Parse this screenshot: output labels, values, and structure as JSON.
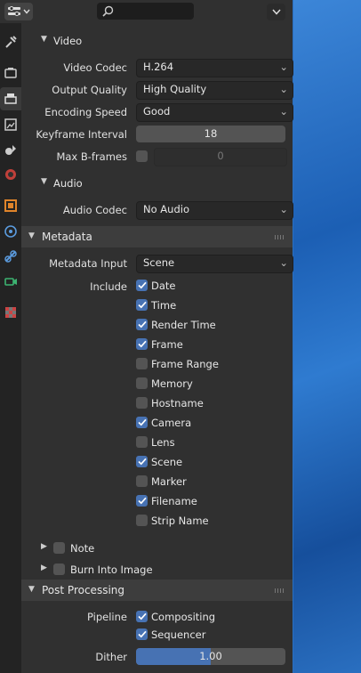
{
  "header": {
    "search_placeholder": ""
  },
  "tabs": [
    "tool-icon",
    "render-icon",
    "output-icon",
    "view-layer-icon",
    "scene-icon",
    "world-icon",
    "object-icon",
    "physics-icon",
    "constraints-icon",
    "data-icon",
    "texture-icon"
  ],
  "video": {
    "title": "Video",
    "codec_label": "Video Codec",
    "codec": "H.264",
    "quality_label": "Output Quality",
    "quality": "High Quality",
    "speed_label": "Encoding Speed",
    "speed": "Good",
    "keyframe_label": "Keyframe Interval",
    "keyframe": "18",
    "bframes_label": "Max B-frames",
    "bframes": "0"
  },
  "audio": {
    "title": "Audio",
    "codec_label": "Audio Codec",
    "codec": "No Audio"
  },
  "metadata": {
    "title": "Metadata",
    "input_label": "Metadata Input",
    "input": "Scene",
    "include_label": "Include",
    "items": [
      {
        "label": "Date",
        "checked": true
      },
      {
        "label": "Time",
        "checked": true
      },
      {
        "label": "Render Time",
        "checked": true
      },
      {
        "label": "Frame",
        "checked": true
      },
      {
        "label": "Frame Range",
        "checked": false
      },
      {
        "label": "Memory",
        "checked": false
      },
      {
        "label": "Hostname",
        "checked": false
      },
      {
        "label": "Camera",
        "checked": true
      },
      {
        "label": "Lens",
        "checked": false
      },
      {
        "label": "Scene",
        "checked": true
      },
      {
        "label": "Marker",
        "checked": false
      },
      {
        "label": "Filename",
        "checked": true
      },
      {
        "label": "Strip Name",
        "checked": false
      }
    ],
    "note": "Note",
    "burn": "Burn Into Image"
  },
  "post": {
    "title": "Post Processing",
    "pipeline_label": "Pipeline",
    "compositing": "Compositing",
    "sequencer": "Sequencer",
    "dither_label": "Dither",
    "dither": "1.00",
    "dither_fraction": 0.5
  },
  "colors": {
    "accent": "#4772b3",
    "panel": "#303030",
    "header": "#3d3d3d"
  }
}
